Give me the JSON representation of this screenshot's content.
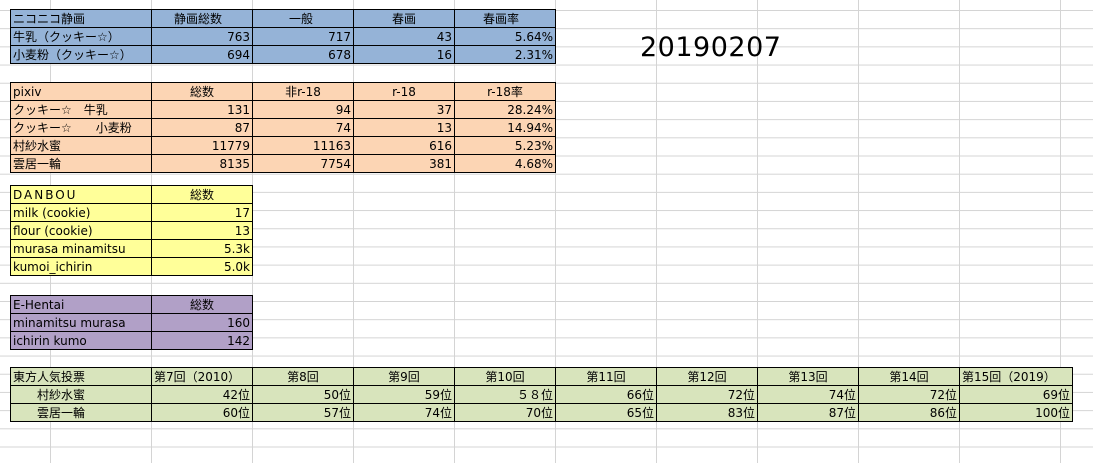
{
  "date_label": "20190207",
  "niconico": {
    "headers": [
      "ニコニコ静画",
      "静画総数",
      "一般",
      "春画",
      "春画率"
    ],
    "rows": [
      [
        "牛乳（クッキー☆）",
        "763",
        "717",
        "43",
        "5.64%"
      ],
      [
        "小麦粉（クッキー☆）",
        "694",
        "678",
        "16",
        "2.31%"
      ]
    ]
  },
  "pixiv": {
    "headers": [
      "pixiv",
      "総数",
      "非r-18",
      "r-18",
      "r-18率"
    ],
    "rows": [
      [
        "クッキー☆　牛乳",
        "131",
        "94",
        "37",
        "28.24%"
      ],
      [
        "クッキー☆　　小麦粉",
        "87",
        "74",
        "13",
        "14.94%"
      ],
      [
        "村紗水蜜",
        "11779",
        "11163",
        "616",
        "5.23%"
      ],
      [
        "雲居一輪",
        "8135",
        "7754",
        "381",
        "4.68%"
      ]
    ]
  },
  "danbooru": {
    "headers": [
      "DANBOU",
      "総数"
    ],
    "rows": [
      [
        "milk (cookie)",
        "17"
      ],
      [
        "flour (cookie)",
        "13"
      ],
      [
        "murasa minamitsu",
        "5.3k"
      ],
      [
        "kumoi_ichirin",
        "5.0k"
      ]
    ]
  },
  "ehentai": {
    "headers": [
      "E-Hentai",
      "総数"
    ],
    "rows": [
      [
        "minamitsu murasa",
        "160"
      ],
      [
        "ichirin kumo",
        "142"
      ]
    ]
  },
  "touhou_poll": {
    "headers": [
      "東方人気投票",
      "第7回（2010）",
      "第8回",
      "第9回",
      "第10回",
      "第11回",
      "第12回",
      "第13回",
      "第14回",
      "第15回（2019）"
    ],
    "rows": [
      [
        "村紗水蜜",
        "42位",
        "50位",
        "59位",
        "５８位",
        "66位",
        "72位",
        "74位",
        "72位",
        "69位"
      ],
      [
        "雲居一輪",
        "60位",
        "57位",
        "74位",
        "70位",
        "65位",
        "83位",
        "87位",
        "86位",
        "100位"
      ]
    ]
  }
}
